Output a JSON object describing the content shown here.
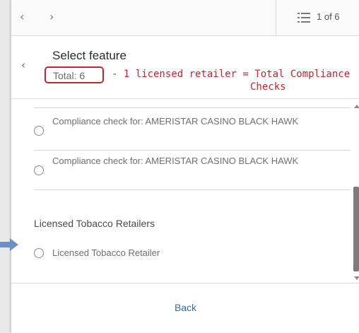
{
  "nav": {
    "prev_glyph": "‹",
    "next_glyph": "›",
    "list_icon": "list-icon",
    "page_count": "1 of 6"
  },
  "header": {
    "back_glyph": "‹",
    "title": "Select feature",
    "total": "Total: 6"
  },
  "annotation": {
    "line1": "- 1 licensed retailer = Total Compliance",
    "line2": "Checks",
    "color": "#c0272d"
  },
  "list": {
    "items": [
      {
        "label": "Compliance check for: AMERISTAR CASINO BLACK HAWK"
      },
      {
        "label": "Compliance check for: AMERISTAR CASINO BLACK HAWK"
      }
    ],
    "group_heading": "Licensed Tobacco Retailers",
    "group_items": [
      {
        "label": "Licensed Tobacco Retailer"
      }
    ]
  },
  "footer": {
    "back_label": "Back",
    "link_color": "#2c6ea8"
  },
  "pointer": {
    "icon": "pointer-arrow-icon",
    "color": "#6b8fc6"
  }
}
